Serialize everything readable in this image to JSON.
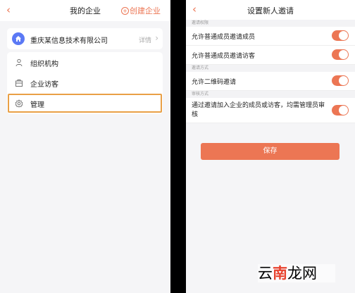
{
  "left": {
    "title": "我的企业",
    "back": "‹",
    "create_label": "创建企业",
    "company": {
      "name": "重庆某信息技术有限公司",
      "detail": "详情",
      "chevron": "›",
      "icon": "home-icon"
    },
    "menu": [
      {
        "label": "组织机构",
        "icon": "org-icon"
      },
      {
        "label": "企业访客",
        "icon": "visitor-icon"
      },
      {
        "label": "管理",
        "icon": "gear-icon",
        "highlighted": true
      }
    ]
  },
  "right": {
    "title": "设置新人邀请",
    "back": "‹",
    "sections": [
      {
        "header": "邀请权限",
        "rows": [
          {
            "label": "允许普通成员邀请成员",
            "on": true
          },
          {
            "label": "允许普通成员邀请访客",
            "on": true
          }
        ]
      },
      {
        "header": "邀请方式",
        "rows": [
          {
            "label": "允许二维码邀请",
            "on": true
          }
        ]
      },
      {
        "header": "审核方式",
        "rows": [
          {
            "label": "通过邀请加入企业的成员或访客，均需管理员审核",
            "on": true
          }
        ]
      }
    ],
    "save_label": "保存"
  },
  "watermark": {
    "pre": "云",
    "hi": "南",
    "post": "龙网"
  },
  "colors": {
    "accent": "#ec7654",
    "avatar": "#5b79f5",
    "highlight_border": "#e9a046"
  }
}
